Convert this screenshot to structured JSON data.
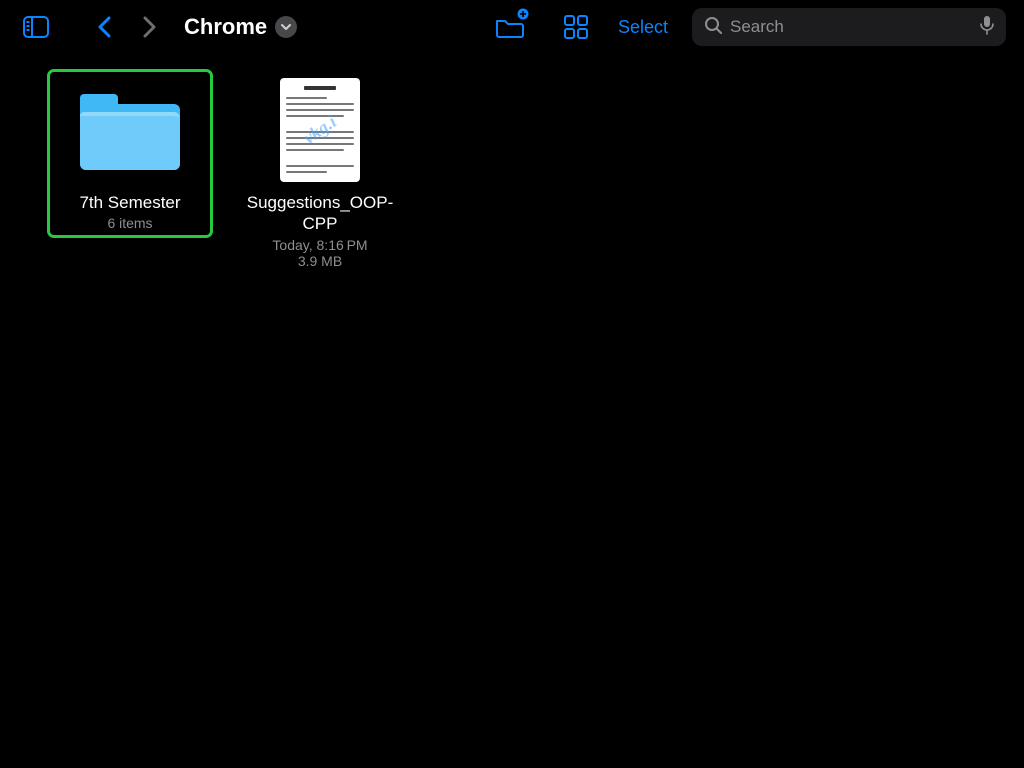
{
  "toolbar": {
    "title": "Chrome",
    "select_label": "Select",
    "search_placeholder": "Search"
  },
  "items": [
    {
      "kind": "folder",
      "name": "7th Semester",
      "sub": "6 items",
      "selected": true
    },
    {
      "kind": "document",
      "name": "Suggestions_OOP-CPP",
      "sub": "Today, 8:16 PM",
      "sub2": "3.9 MB",
      "watermark": "vkg.i",
      "selected": false
    }
  ]
}
